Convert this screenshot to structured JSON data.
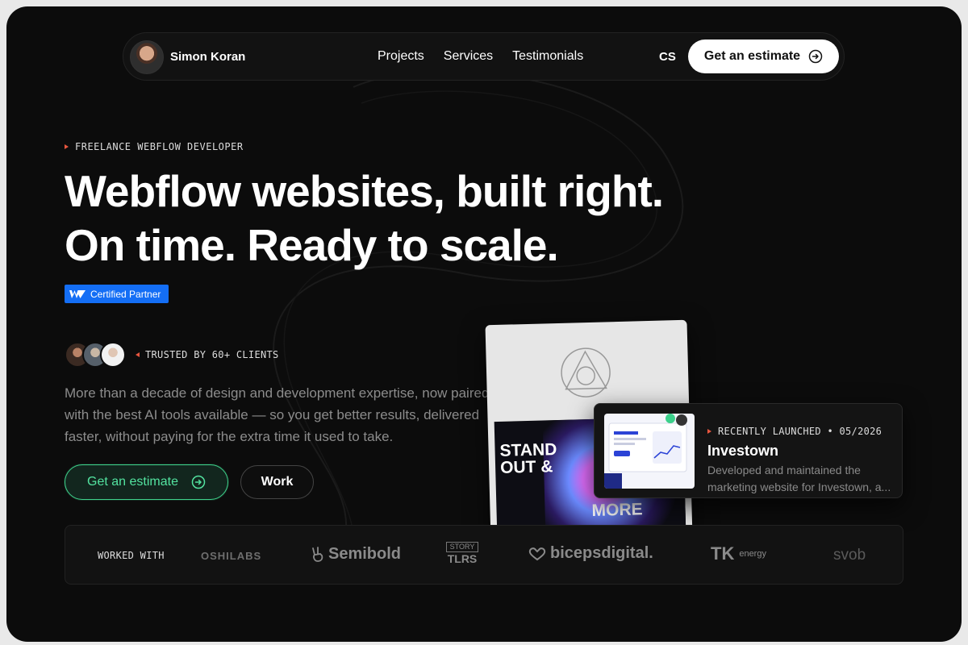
{
  "nav": {
    "name": "Simon Koran",
    "links": [
      "Projects",
      "Services",
      "Testimonials"
    ],
    "lang": "CS",
    "cta": "Get an estimate"
  },
  "hero": {
    "eyebrow": "FREELANCE WEBFLOW DEVELOPER",
    "headline_line1": "Webflow websites, built right.",
    "headline_line2": "On time. Ready to scale.",
    "badge": "Certified Partner",
    "trusted": "TRUSTED BY 60+ CLIENTS",
    "description": "More than a decade of design and development expertise, now paired with the best AI tools available — so you get better results, delivered faster, without paying for the extra time it used to take.",
    "primary_button": "Get an estimate",
    "secondary_button": "Work"
  },
  "poster": {
    "line1": "STAND",
    "line2": "OUT &",
    "line3": "MORE"
  },
  "project_card": {
    "eyebrow": "RECENTLY LAUNCHED • 05/2026",
    "title": "Investown",
    "desc_line1": "Developed and maintained the",
    "desc_line2": "marketing website for Investown, a..."
  },
  "logos": {
    "label": "WORKED WITH",
    "items": {
      "oshilabs": "OSHILABS",
      "semibold": "Semibold",
      "story_top": "STORY",
      "story_bottom": "TLRS",
      "biceps": "bicepsdigital.",
      "tk": "TK",
      "tk_sub": "energy",
      "svob": "svob"
    }
  },
  "colors": {
    "accent_green": "#53e3a0",
    "accent_red": "#e8563f",
    "webflow_blue": "#146ef5",
    "background": "#0c0c0c"
  }
}
